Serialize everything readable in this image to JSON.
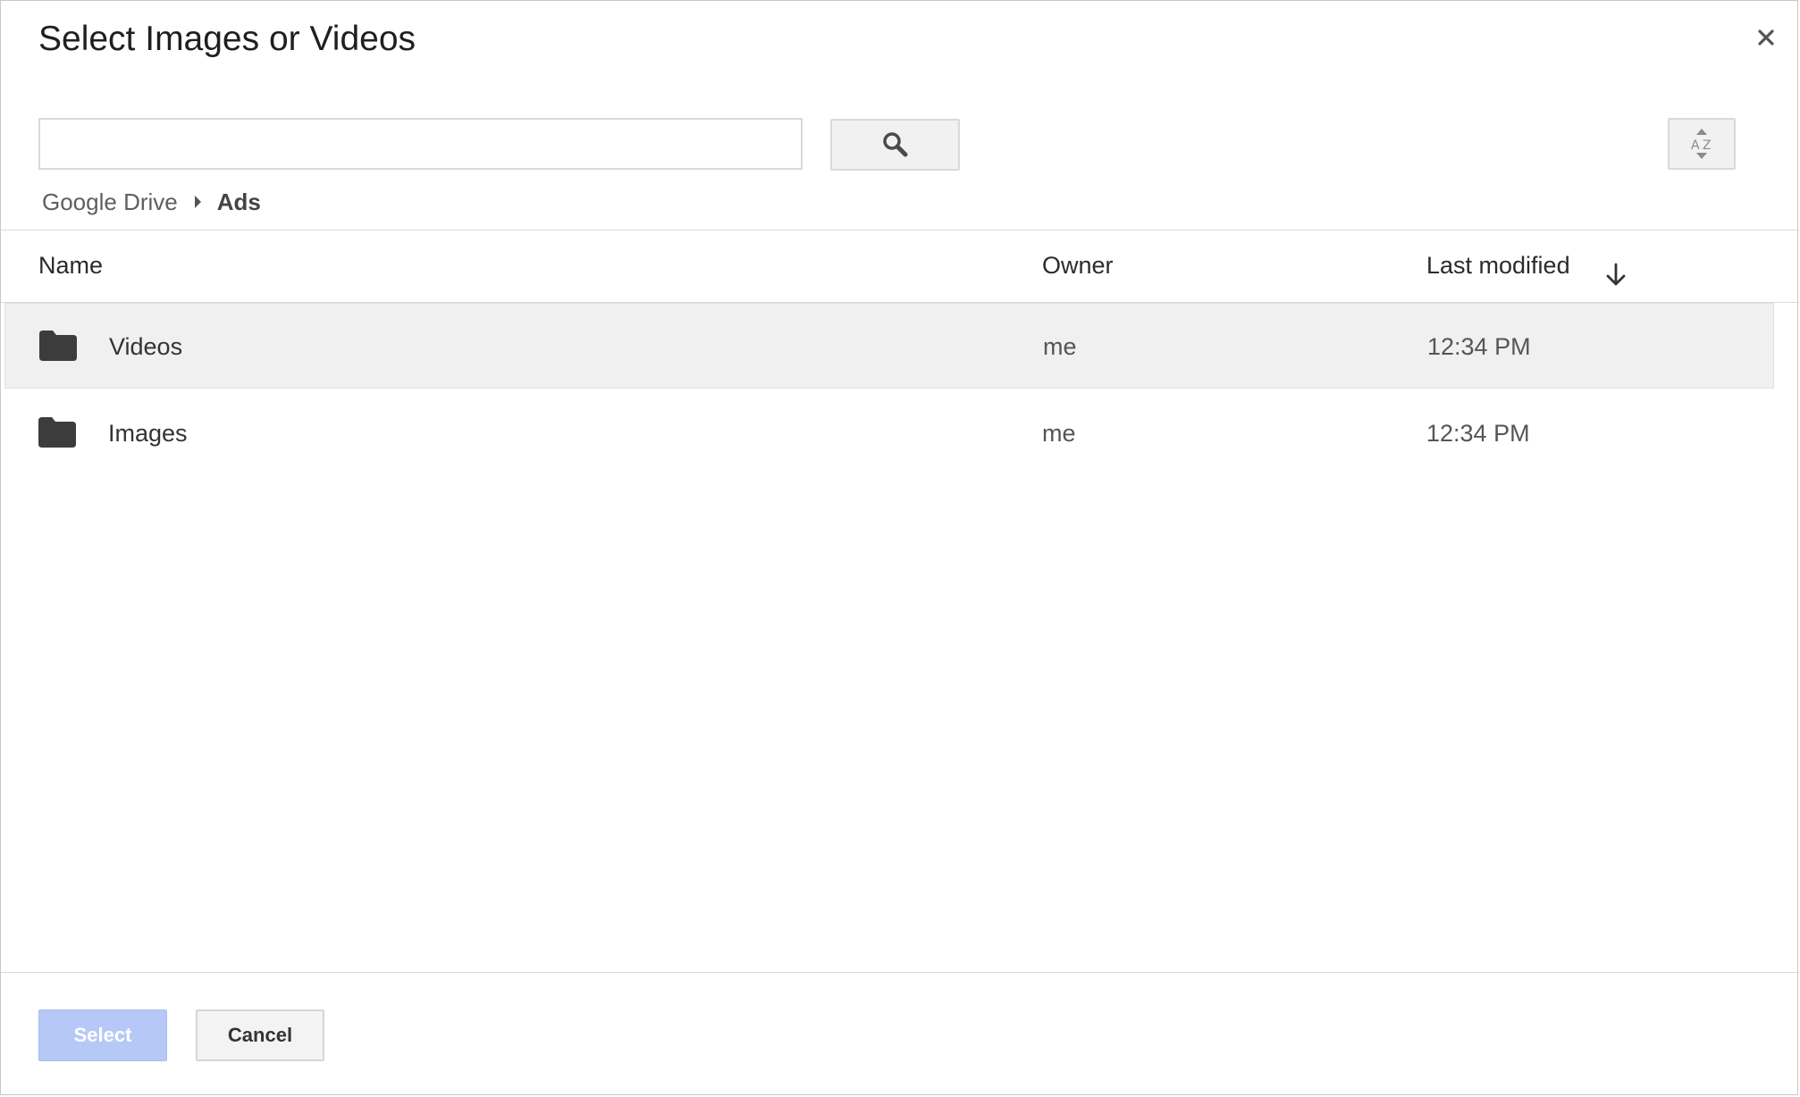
{
  "dialog": {
    "title": "Select Images or Videos",
    "close_icon": "close-icon"
  },
  "search": {
    "value": "",
    "placeholder": "",
    "button_icon": "search-icon"
  },
  "sort_button": {
    "icon": "sort-az-icon"
  },
  "breadcrumb": {
    "root": "Google Drive",
    "separator_icon": "chevron-right-icon",
    "current": "Ads"
  },
  "table": {
    "columns": [
      "Name",
      "Owner",
      "Last modified"
    ],
    "sort_indicator_icon": "arrow-down-icon",
    "sorted_by": "Last modified",
    "rows": [
      {
        "icon": "folder-icon",
        "name": "Videos",
        "owner": "me",
        "modified": "12:34 PM",
        "selected": true
      },
      {
        "icon": "folder-icon",
        "name": "Images",
        "owner": "me",
        "modified": "12:34 PM",
        "selected": false
      }
    ]
  },
  "footer": {
    "select_label": "Select",
    "cancel_label": "Cancel"
  },
  "colors": {
    "select_button_disabled": "#b6c8f5",
    "row_selected_bg": "#f0f0f0",
    "folder_icon": "#3c3c3c"
  }
}
